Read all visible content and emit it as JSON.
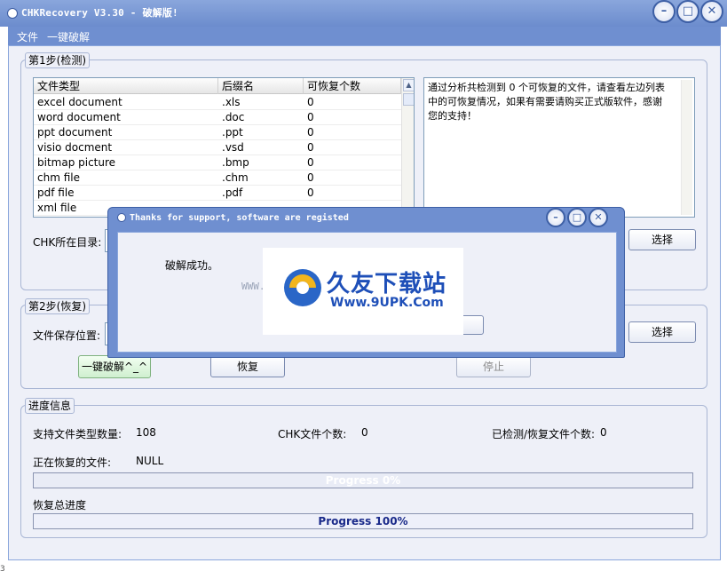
{
  "window": {
    "title": "CHKRecovery V3.30 - 破解版!"
  },
  "menu": [
    "文件",
    "一键破解"
  ],
  "step1": {
    "title": "第1步(检测)",
    "columns": [
      "文件类型",
      "后缀名",
      "可恢复个数"
    ],
    "rows": [
      [
        "excel document",
        ".xls",
        "0"
      ],
      [
        "word document",
        ".doc",
        "0"
      ],
      [
        "ppt document",
        ".ppt",
        "0"
      ],
      [
        "visio docment",
        ".vsd",
        "0"
      ],
      [
        "bitmap picture",
        ".bmp",
        "0"
      ],
      [
        "chm file",
        ".chm",
        "0"
      ],
      [
        "pdf file",
        ".pdf",
        "0"
      ],
      [
        "xml file",
        "",
        ""
      ]
    ],
    "message": "通过分析共检测到 0 个可恢复的文件，请查看左边列表中的可恢复情况，如果有需要请购买正式版软件，感谢您的支持！",
    "dir_label": "CHK所在目录:",
    "select_label": "选择"
  },
  "step2": {
    "title": "第2步(恢复)",
    "save_label": "文件保存位置:",
    "select_label": "选择",
    "crack_button": "一键破解^_^",
    "restore_button": "恢复",
    "stop_button": "停止"
  },
  "progress": {
    "title": "进度信息",
    "types_label": "支持文件类型数量:",
    "types_value": "108",
    "chk_label": "CHK文件个数:",
    "chk_value": "0",
    "detected_label": "已检测/恢复文件个数:",
    "detected_value": "0",
    "current_label": "正在恢复的文件:",
    "current_value": "NULL",
    "bar1_text": "Progress 0%",
    "bar1_value": 0,
    "total_label": "恢复总进度",
    "bar2_text": "Progress 100%",
    "bar2_value": 1
  },
  "dialog": {
    "title": "Thanks for support, software are registed",
    "message": "破解成功。"
  },
  "watermark": {
    "url_left": "WWW.9U",
    "name": "久友下载站",
    "url": "Www.9UPK.Com"
  },
  "colors": {
    "titlebar": "#6c8ccd",
    "progress_fill": "#2b3ea6",
    "accent": "#3d5fa5"
  },
  "icons": [
    "app-icon",
    "minimize-icon",
    "maximize-icon",
    "close-icon",
    "scroll-up-icon",
    "scroll-down-icon"
  ]
}
